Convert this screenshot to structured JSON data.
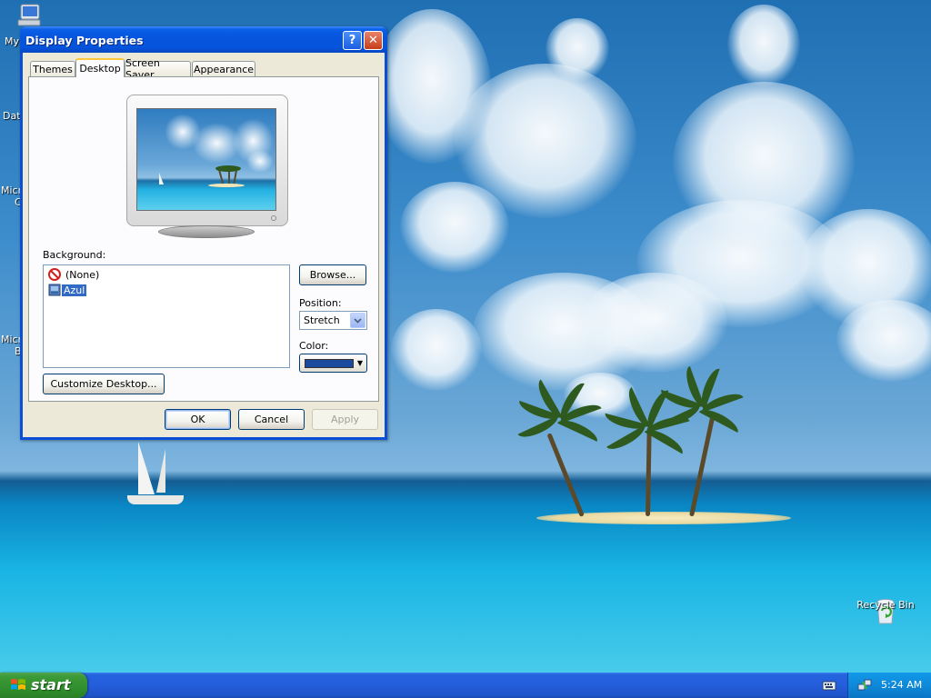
{
  "desktop": {
    "icons": {
      "my_computer": "My",
      "recycle_bin": "Recycle Bin"
    },
    "side_labels": [
      "Dat",
      "Micr",
      "C",
      "Micr",
      "B"
    ]
  },
  "window": {
    "title": "Display Properties",
    "help_glyph": "?",
    "close_glyph": "✕",
    "tabs": [
      {
        "label": "Themes"
      },
      {
        "label": "Desktop",
        "active": true
      },
      {
        "label": "Screen Saver"
      },
      {
        "label": "Appearance"
      }
    ],
    "background_label": "Background:",
    "background_items": [
      {
        "label": "(None)",
        "icon": "no-entry-icon"
      },
      {
        "label": "Azul",
        "icon": "image-file-icon",
        "selected": true
      }
    ],
    "browse_label": "Browse...",
    "position_label": "Position:",
    "position_value": "Stretch",
    "color_label": "Color:",
    "color_value": "#1a4a9e",
    "customize_label": "Customize Desktop...",
    "ok_label": "OK",
    "cancel_label": "Cancel",
    "apply_label": "Apply"
  },
  "taskbar": {
    "start_label": "start",
    "time": "5:24 AM"
  }
}
